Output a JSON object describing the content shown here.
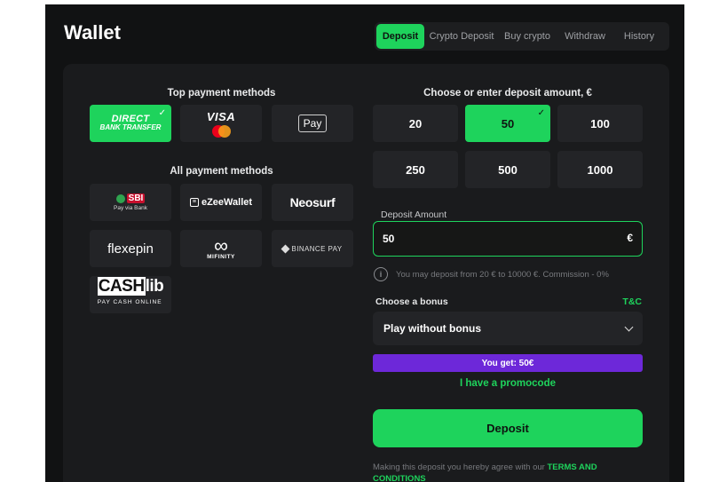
{
  "header": {
    "title": "Wallet"
  },
  "tabs": [
    {
      "label": "Deposit",
      "active": true
    },
    {
      "label": "Crypto Deposit",
      "active": false
    },
    {
      "label": "Buy crypto",
      "active": false
    },
    {
      "label": "Withdraw",
      "active": false
    },
    {
      "label": "History",
      "active": false
    }
  ],
  "payment": {
    "top_title": "Top payment methods",
    "all_title": "All payment methods",
    "direct": {
      "line1": "DIRECT",
      "line2": "BANK TRANSFER",
      "selected": true
    },
    "visa": {
      "label": "VISA"
    },
    "apple_pay": {
      "label": "Pay"
    },
    "pay_via_bank": {
      "logo": "SBI",
      "sub": "Pay via Bank"
    },
    "ezee": {
      "label": "eZeeWallet"
    },
    "neosurf": {
      "label": "Neosurf"
    },
    "flexepin": {
      "label": "flexepin"
    },
    "mifinity": {
      "label": "MIFINITY"
    },
    "binance": {
      "label": "BINANCE PAY"
    },
    "cashlib": {
      "box": "CASH",
      "rest": "lib",
      "sub": "PAY CASH ONLINE"
    }
  },
  "amounts": {
    "title": "Choose or enter deposit amount, €",
    "options": [
      "20",
      "50",
      "100",
      "250",
      "500",
      "1000"
    ],
    "selected": "50"
  },
  "deposit_amount": {
    "label": "Deposit Amount",
    "value": "50",
    "currency": "€"
  },
  "info": {
    "text": "You may deposit from 20 € to 10000 €. Commission - 0%"
  },
  "bonus": {
    "label": "Choose a bonus",
    "tc": "T&C",
    "selected": "Play without bonus"
  },
  "you_get": "You get: 50€",
  "promo": "I have a promocode",
  "deposit_button": "Deposit",
  "terms": {
    "text": "Making this deposit you hereby agree with our ",
    "link": "TERMS AND CONDITIONS"
  },
  "colors": {
    "accent": "#1ed35c",
    "purple": "#6d28d9",
    "background": "#111213",
    "panel": "#1a1b1d",
    "tile": "#232427"
  }
}
